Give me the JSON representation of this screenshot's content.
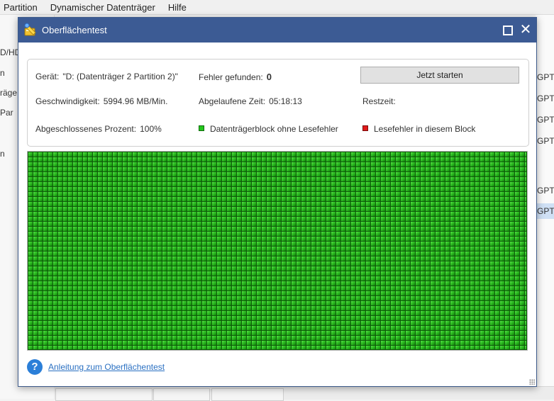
{
  "app": {
    "menu": [
      "Partition",
      "Dynamischer Datenträger",
      "Hilfe"
    ],
    "side_labels": [
      "D/HD",
      "n",
      "räge",
      "Par",
      "n"
    ],
    "gpt_labels": [
      "GPT",
      "GPT",
      "GPT",
      "GPT",
      "GPT",
      "GPT"
    ]
  },
  "dialog": {
    "title": "Oberflächentest",
    "title_icon": "surface-test-icon",
    "device_label": "Gerät:",
    "device_value": "\"D: (Datenträger 2 Partition 2)\"",
    "errors_label": "Fehler gefunden:",
    "errors_value": "0",
    "start_button": "Jetzt starten",
    "speed_label": "Geschwindigkeit:",
    "speed_value": "5994.96 MB/Min.",
    "elapsed_label": "Abgelaufene Zeit:",
    "elapsed_value": "05:18:13",
    "remaining_label": "Restzeit:",
    "remaining_value": "",
    "percent_label": "Abgeschlossenes Prozent:",
    "percent_value": "100%",
    "legend_ok": "Datenträgerblock ohne Lesefehler",
    "legend_error": "Lesefehler in diesem Block",
    "legend_ok_color": "#24c51d",
    "legend_error_color": "#e01a1a",
    "progress_fraction": 1.0,
    "help_link": "Anleitung zum Oberflächentest"
  }
}
